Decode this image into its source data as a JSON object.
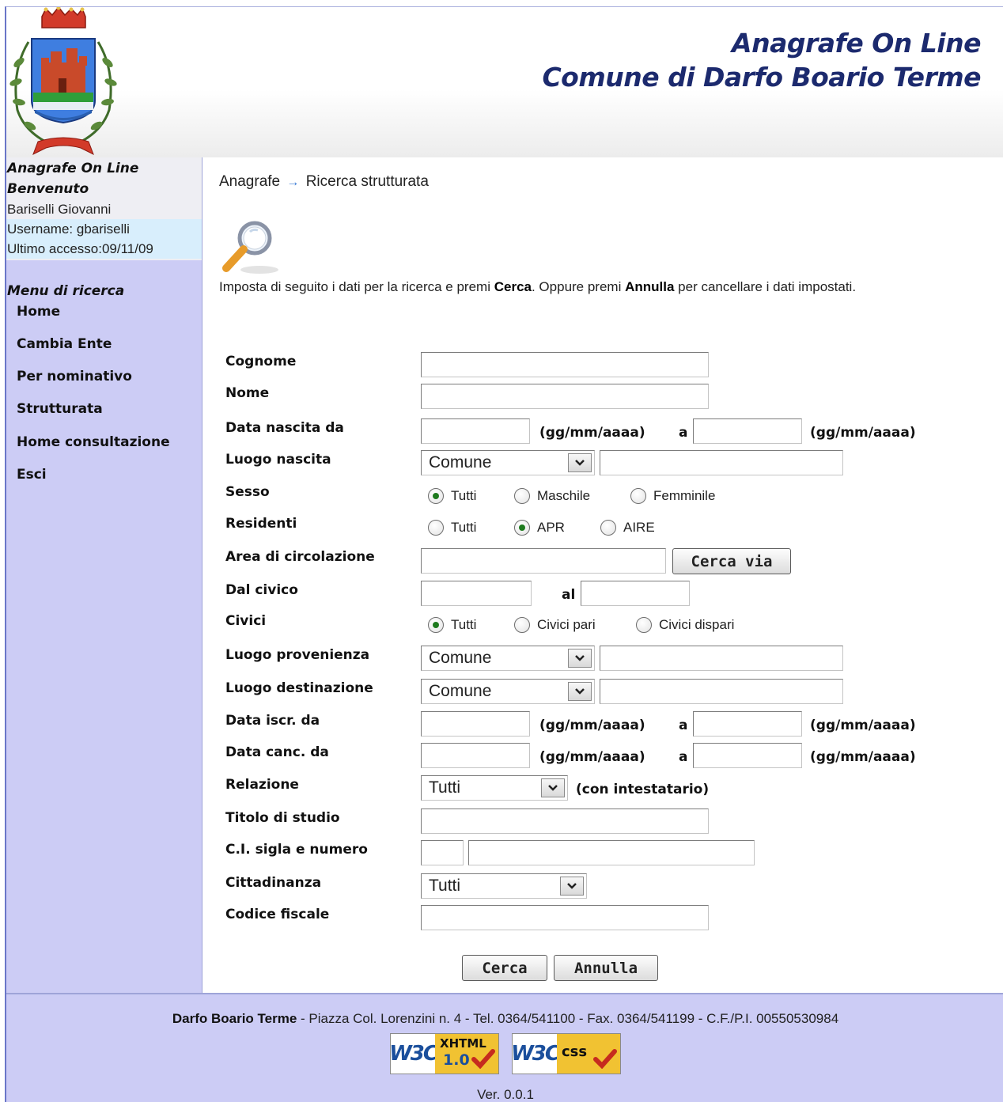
{
  "header": {
    "title_line1": "Anagrafe On Line",
    "title_line2": "Comune di Darfo Boario Terme"
  },
  "sidebar": {
    "app_name": "Anagrafe On Line",
    "welcome": "Benvenuto",
    "user_name": "Bariselli Giovanni",
    "username": "Username: gbariselli",
    "last_access": "Ultimo accesso:09/11/09",
    "menu_title": "Menu di ricerca",
    "items": [
      {
        "label": "Home"
      },
      {
        "label": "Cambia Ente"
      },
      {
        "label": "Per nominativo"
      },
      {
        "label": "Strutturata"
      },
      {
        "label": "Home consultazione"
      },
      {
        "label": "Esci"
      }
    ]
  },
  "breadcrumb": {
    "root": "Anagrafe",
    "arrow": "→",
    "current": "Ricerca strutturata"
  },
  "instructions": {
    "part1": "Imposta di seguito i dati per la ricerca e premi ",
    "cerca": "Cerca",
    "part2": ".  Oppure premi ",
    "annulla": "Annulla",
    "part3": " per cancellare i dati impostati."
  },
  "form": {
    "cognome": "Cognome",
    "nome": "Nome",
    "data_nascita_da": "Data nascita da",
    "luogo_nascita": "Luogo nascita",
    "sesso": "Sesso",
    "residenti": "Residenti",
    "area_circolazione": "Area di circolazione",
    "dal_civico": "Dal civico",
    "civici": "Civici",
    "luogo_provenienza": "Luogo provenienza",
    "luogo_destinazione": "Luogo destinazione",
    "data_iscr_da": "Data iscr. da",
    "data_canc_da": "Data canc. da",
    "relazione": "Relazione",
    "titolo_studio": "Titolo di studio",
    "ci_sigla_numero": "C.I. sigla e numero",
    "cittadinanza": "Cittadinanza",
    "codice_fiscale": "Codice fiscale",
    "date_format": "(gg/mm/aaaa)",
    "a": "a",
    "al": "al",
    "con_intestatario": "(con intestatario)",
    "select_comune": "Comune",
    "select_tutti": "Tutti",
    "sesso_options": [
      "Tutti",
      "Maschile",
      "Femminile"
    ],
    "residenti_options": [
      "Tutti",
      "APR",
      "AIRE"
    ],
    "civici_options": [
      "Tutti",
      "Civici pari",
      "Civici dispari"
    ],
    "cerca_via_button": "Cerca via",
    "cerca_button": "Cerca",
    "annulla_button": "Annulla"
  },
  "footer": {
    "org": "Darfo Boario Terme",
    "address": " - Piazza Col. Lorenzini n. 4 - Tel. 0364/541100 - Fax. 0364/541199 - C.F./P.I. 00550530984",
    "badge_w3c": "W3C",
    "badge_xhtml": "XHTML",
    "badge_xhtml_ver": "1.0",
    "badge_css": "css",
    "version": "Ver. 0.0.1"
  },
  "colors": {
    "sidebar_bg": "#ccccf5",
    "title_color": "#1c2a6e",
    "radio_dot": "#1e7a1e",
    "badge_yellow": "#f1c232"
  }
}
